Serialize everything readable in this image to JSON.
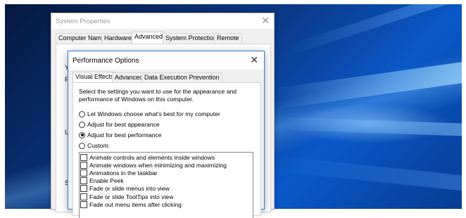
{
  "system_properties": {
    "title": "System Properties",
    "close_glyph": "✕",
    "tabs": [
      "Computer Name",
      "Hardware",
      "Advanced",
      "System Protection",
      "Remote"
    ],
    "active_tab": "Advanced",
    "peek_letters": [
      "Y",
      "P",
      "U",
      "S"
    ]
  },
  "performance_options": {
    "title": "Performance Options",
    "close_glyph": "✕",
    "tabs": [
      "Visual Effects",
      "Advanced",
      "Data Execution Prevention"
    ],
    "active_tab": "Visual Effects",
    "intro": "Select the settings you want to use for the appearance and performance of Windows on this computer.",
    "radio_options": [
      {
        "label": "Let Windows choose what's best for my computer",
        "checked": false
      },
      {
        "label": "Adjust for best appearance",
        "checked": false
      },
      {
        "label": "Adjust for best performance",
        "checked": true
      },
      {
        "label": "Custom:",
        "checked": false
      }
    ],
    "checklist": [
      {
        "label": "Animate controls and elements inside windows",
        "checked": false
      },
      {
        "label": "Animate windows when minimizing and maximizing",
        "checked": false
      },
      {
        "label": "Animations in the taskbar",
        "checked": false
      },
      {
        "label": "Enable Peek",
        "checked": false
      },
      {
        "label": "Fade or slide menus into view",
        "checked": false
      },
      {
        "label": "Fade or slide ToolTips into view",
        "checked": false
      },
      {
        "label": "Fade out menu items after clicking",
        "checked": false
      }
    ]
  }
}
